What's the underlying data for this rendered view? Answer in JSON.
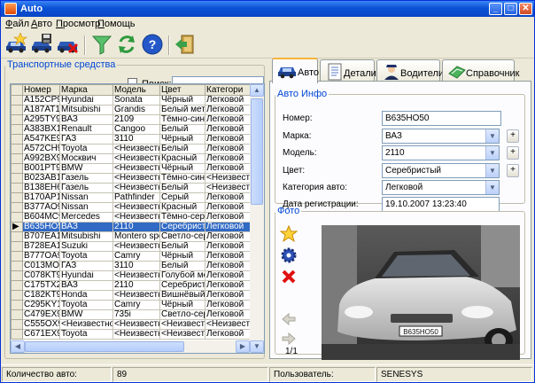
{
  "window": {
    "title": "Auto"
  },
  "menu": [
    {
      "accel": "Ф",
      "rest": "айл"
    },
    {
      "accel": "А",
      "rest": "вто"
    },
    {
      "accel": "П",
      "rest": "росмотр"
    },
    {
      "accel": "П",
      "rest": "омощь"
    }
  ],
  "left": {
    "group_title": "Транспортные средства",
    "search_label": "Поиск:",
    "search_value": "",
    "columns": [
      "Номер",
      "Марка",
      "Модель",
      "Цвет",
      "Категори"
    ],
    "rows": [
      [
        "A152CP97",
        "Hyundai",
        "Sonata",
        "Чёрный",
        "Легковой"
      ],
      [
        "A187AT17",
        "Mitsubishi",
        "Grandis",
        "Белый мета",
        "Легковой"
      ],
      [
        "A295TY99",
        "ВАЗ",
        "2109",
        "Тёмно-сини",
        "Легковой"
      ],
      [
        "A383BX17",
        "Renault",
        "Cangoo",
        "Белый",
        "Легковой"
      ],
      [
        "A547KE99",
        "ГАЗ",
        "3110",
        "Чёрный",
        "Легковой"
      ],
      [
        "A572CH99",
        "Toyota",
        "<Неизвестно",
        "Белый",
        "Легковой"
      ],
      [
        "A992BX99",
        "Москвич",
        "<Неизвестно",
        "Красный",
        "Легковой"
      ],
      [
        "B001PT97",
        "BMW",
        "<Неизвестно",
        "Чёрный",
        "Легковой"
      ],
      [
        "B023AB17",
        "Газель",
        "<Неизвестно",
        "Тёмно-сини",
        "<Неизвест"
      ],
      [
        "B138EH69",
        "Газель",
        "<Неизвестно",
        "Белый",
        "<Неизвест"
      ],
      [
        "B170AP17",
        "Nissan",
        "Pathfinder",
        "Серый",
        "Легковой"
      ],
      [
        "B377AO99",
        "Nissan",
        "<Неизвестно",
        "Красный",
        "Легковой"
      ],
      [
        "B604MC97",
        "Mercedes",
        "<Неизвестно",
        "Тёмно-серь",
        "Легковой"
      ],
      [
        "B635HO50",
        "ВАЗ",
        "2110",
        "Серебристы",
        "Легковой"
      ],
      [
        "B707EA17",
        "Mitsubishi",
        "Montero sport",
        "Светло-сере",
        "Легковой"
      ],
      [
        "B728EA17",
        "Suzuki",
        "<Неизвестно",
        "Белый",
        "Легковой"
      ],
      [
        "B777OA97",
        "Toyota",
        "Camry",
        "Чёрный",
        "Легковой"
      ],
      [
        "C013MO99",
        "ГАЗ",
        "3110",
        "Белый",
        "Легковой"
      ],
      [
        "C078KT97",
        "Hyundai",
        "<Неизвестно",
        "Голубой мет",
        "Легковой"
      ],
      [
        "C175TX26",
        "ВАЗ",
        "2110",
        "Серебристы",
        "Легковой"
      ],
      [
        "C182KT97",
        "Honda",
        "<Неизвестно",
        "Вишнёвый",
        "Легковой"
      ],
      [
        "C295KY17",
        "Toyota",
        "Camry",
        "Чёрный",
        "Легковой"
      ],
      [
        "C479EX97",
        "BMW",
        "735i",
        "Светло-сере",
        "Легковой"
      ],
      [
        "C555OX97",
        "<Неизвестно",
        "<Неизвестно",
        "<Неизвестно",
        "<Неизвест"
      ],
      [
        "C671EX97",
        "Toyota",
        "<Неизвестно",
        "<Неизвестно",
        "Легковой"
      ]
    ],
    "selected_row": 13
  },
  "tabs": [
    "Авто",
    "Детали",
    "Водители",
    "Справочник"
  ],
  "info": {
    "group_title": "Авто Инфо",
    "fields": [
      {
        "label": "Номер:",
        "value": "B635HO50"
      },
      {
        "label": "Марка:",
        "value": "ВАЗ"
      },
      {
        "label": "Модель:",
        "value": "2110"
      },
      {
        "label": "Цвет:",
        "value": "Серебристый"
      },
      {
        "label": "Категория авто:",
        "value": "Легковой"
      },
      {
        "label": "Дата регистрации:",
        "value": "19.10.2007 13:23:40"
      }
    ]
  },
  "photo": {
    "group_title": "Фото",
    "counter": "1/1",
    "plate_text": "B635HO50"
  },
  "status": {
    "count_label": "Количество авто:",
    "count_value": "89",
    "user_label": "Пользователь:",
    "user_value": "SENESYS"
  },
  "colors": {
    "accent": "#0046d5",
    "selection": "#316ac5",
    "titlebar": "#0a52d6"
  },
  "icons": {
    "toolbar": [
      "add-car-icon",
      "save-car-icon",
      "delete-car-icon",
      "filter-icon",
      "refresh-icon",
      "help-icon",
      "exit-icon"
    ],
    "photo_buttons": [
      "add-photo-icon",
      "settings-icon",
      "delete-photo-icon",
      "prev-photo-icon",
      "next-photo-icon"
    ]
  }
}
